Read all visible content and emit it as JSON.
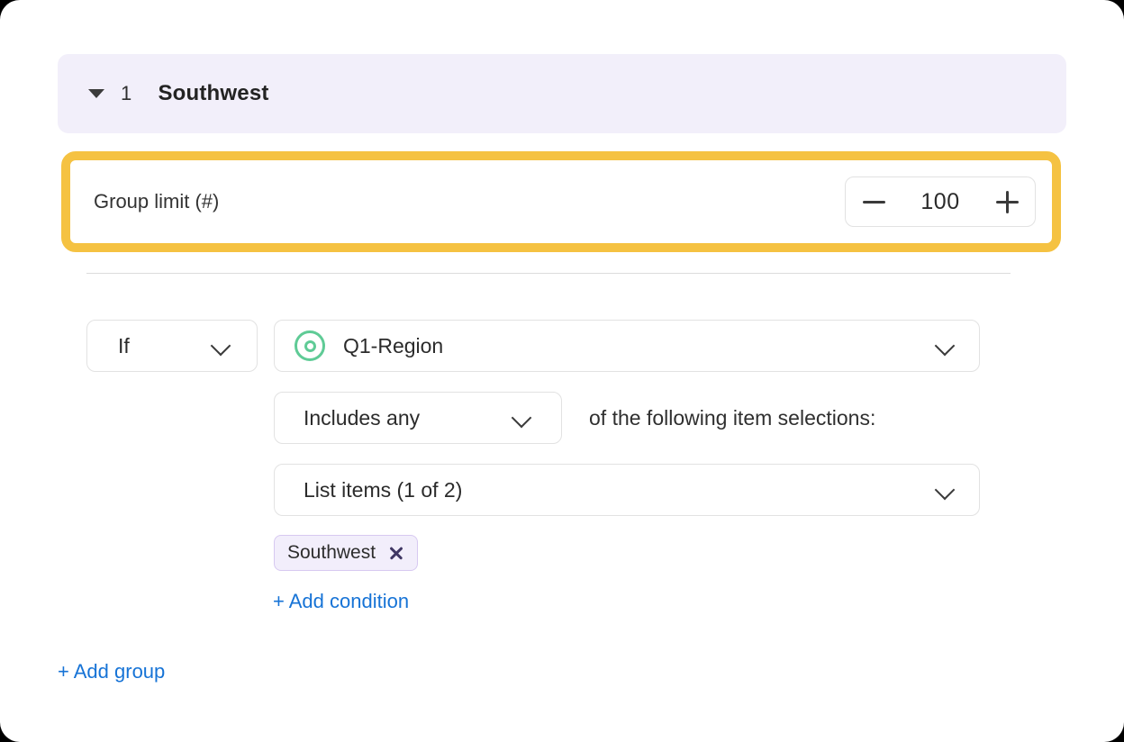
{
  "group": {
    "caret_icon": "caret-down-icon",
    "index": "1",
    "title": "Southwest"
  },
  "limit": {
    "label": "Group limit (#)",
    "value": "100",
    "decrement_icon": "minus-icon",
    "increment_icon": "plus-icon",
    "highlight_color": "#F5C242"
  },
  "condition": {
    "connector": {
      "value": "If",
      "chevron_icon": "chevron-down-icon"
    },
    "target": {
      "icon": "radio-selected-icon",
      "icon_color": "#5FCB96",
      "value": "Q1-Region",
      "chevron_icon": "chevron-down-icon"
    },
    "operator": {
      "value": "Includes any",
      "chevron_icon": "chevron-down-icon"
    },
    "operator_suffix": "of the following item selections:",
    "list": {
      "value": "List items (1 of 2)",
      "chevron_icon": "chevron-down-icon"
    },
    "chips": [
      {
        "label": "Southwest",
        "remove_icon": "close-icon"
      }
    ]
  },
  "actions": {
    "add_condition": "+ Add condition",
    "add_group": "+ Add group",
    "link_color": "#1673D6"
  }
}
